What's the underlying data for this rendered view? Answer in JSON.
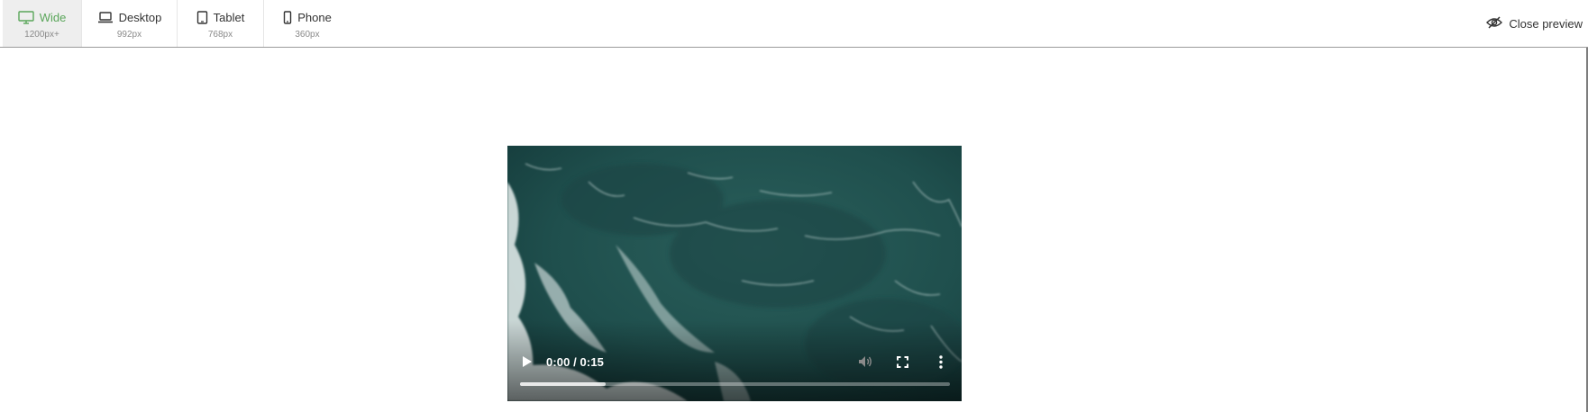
{
  "toolbar": {
    "devices": [
      {
        "label": "Wide",
        "size": "1200px+",
        "icon": "monitor-icon",
        "active": true
      },
      {
        "label": "Desktop",
        "size": "992px",
        "icon": "laptop-icon",
        "active": false
      },
      {
        "label": "Tablet",
        "size": "768px",
        "icon": "tablet-icon",
        "active": false
      },
      {
        "label": "Phone",
        "size": "360px",
        "icon": "phone-icon",
        "active": false
      }
    ],
    "close_preview": {
      "label": "Close preview",
      "icon": "eye-slash-icon"
    }
  },
  "video": {
    "time_display": "0:00 / 0:15",
    "buffered_fraction": 0.2,
    "controls": {
      "play": "play-icon",
      "mute": "volume-icon",
      "fullscreen": "fullscreen-icon",
      "more": "more-vertical-icon"
    }
  },
  "colors": {
    "accent": "#5aa65a",
    "text": "#333333",
    "muted": "#8a8a8a",
    "active_tab_bg": "#eeeeee",
    "ocean": "#1b4a4a"
  }
}
